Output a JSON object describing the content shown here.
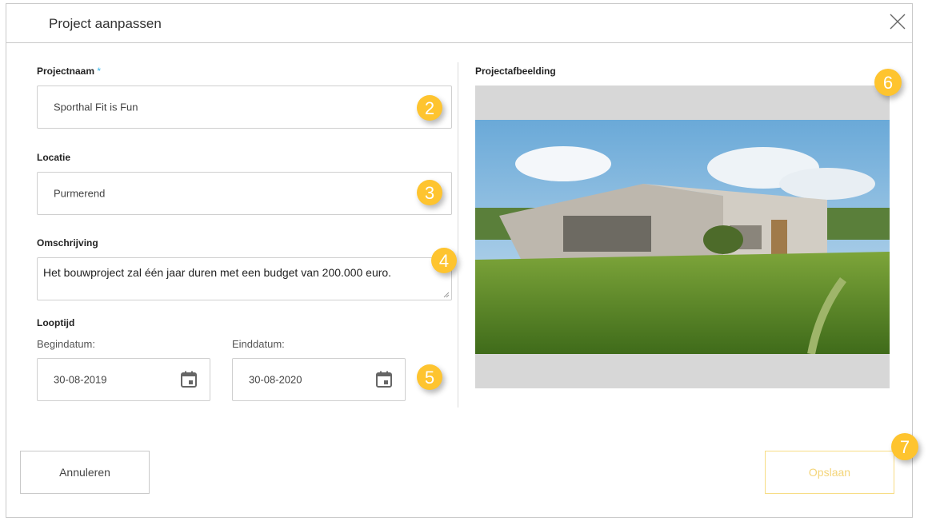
{
  "dialog": {
    "title": "Project aanpassen"
  },
  "form": {
    "projectnaam": {
      "label": "Projectnaam",
      "required_marker": "*",
      "value": "Sporthal Fit is Fun"
    },
    "locatie": {
      "label": "Locatie",
      "value": "Purmerend"
    },
    "omschrijving": {
      "label": "Omschrijving",
      "value": "Het bouwproject zal één jaar duren met een budget van 200.000 euro."
    },
    "looptijd": {
      "label": "Looptijd",
      "begin_label": "Begindatum:",
      "begin_value": "30-08-2019",
      "eind_label": "Einddatum:",
      "eind_value": "30-08-2020"
    },
    "afbeelding": {
      "label": "Projectafbeelding"
    }
  },
  "buttons": {
    "cancel": "Annuleren",
    "save": "Opslaan"
  },
  "badges": [
    "2",
    "3",
    "4",
    "5",
    "6",
    "7"
  ],
  "colors": {
    "badge": "#fec42f",
    "required": "#39b5e8",
    "save_border": "#f7dc84",
    "save_text": "#f4d57a"
  },
  "icons": {
    "close": "close-icon",
    "calendar": "calendar-icon"
  }
}
